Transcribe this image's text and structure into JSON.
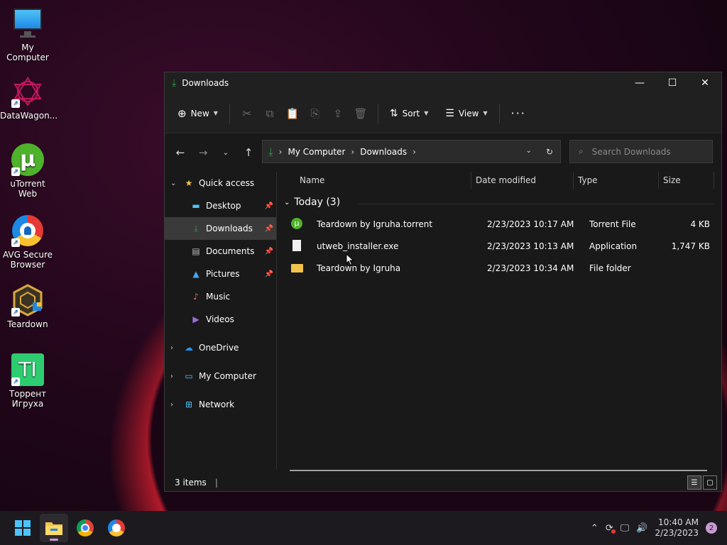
{
  "desktop": {
    "icons": [
      {
        "label": "My Computer"
      },
      {
        "label": "DataWagon..."
      },
      {
        "label": "uTorrent Web"
      },
      {
        "label": "AVG Secure Browser"
      },
      {
        "label": "Teardown"
      },
      {
        "label": "Торрент Игруха"
      }
    ]
  },
  "window": {
    "title": "Downloads",
    "toolbar": {
      "new_label": "New",
      "sort_label": "Sort",
      "view_label": "View"
    },
    "address": {
      "crumbs": [
        "My Computer",
        "Downloads"
      ]
    },
    "search": {
      "placeholder": "Search Downloads"
    },
    "sidebar": {
      "quick_access": "Quick access",
      "items": [
        {
          "label": "Desktop"
        },
        {
          "label": "Downloads"
        },
        {
          "label": "Documents"
        },
        {
          "label": "Pictures"
        },
        {
          "label": "Music"
        },
        {
          "label": "Videos"
        }
      ],
      "onedrive": "OneDrive",
      "my_computer": "My Computer",
      "network": "Network"
    },
    "columns": {
      "name": "Name",
      "date": "Date modified",
      "type": "Type",
      "size": "Size"
    },
    "group": "Today (3)",
    "files": [
      {
        "name": "Teardown by Igruha.torrent",
        "date": "2/23/2023 10:17 AM",
        "type": "Torrent File",
        "size": "4 KB"
      },
      {
        "name": "utweb_installer.exe",
        "date": "2/23/2023 10:13 AM",
        "type": "Application",
        "size": "1,747 KB"
      },
      {
        "name": "Teardown by Igruha",
        "date": "2/23/2023 10:34 AM",
        "type": "File folder",
        "size": ""
      }
    ],
    "status": "3 items"
  },
  "taskbar": {
    "time": "10:40 AM",
    "date": "2/23/2023",
    "notifications": "2"
  },
  "colors": {
    "accent_green": "#2ea043",
    "folder": "#f3c24b",
    "utorrent": "#4eb22b"
  }
}
